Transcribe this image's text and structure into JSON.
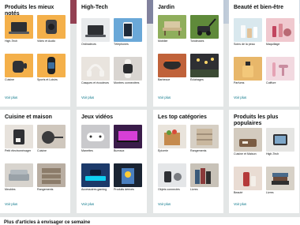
{
  "cards": [
    {
      "title": "Produits les mieux notés",
      "see_more": "Voir plus",
      "tiles": [
        {
          "caption": "High-Tech",
          "icon": "laptop-image",
          "bg": "#f4b04a"
        },
        {
          "caption": "Vidéo et Audio",
          "icon": "speaker-image",
          "bg": "#f4b04a"
        },
        {
          "caption": "Cuisine",
          "icon": "kettle-image",
          "bg": "#f4b04a"
        },
        {
          "caption": "Sports et Loisirs",
          "icon": "fitness-band-image",
          "bg": "#f4b04a"
        }
      ]
    },
    {
      "title": "High-Tech",
      "see_more": "Voir plus",
      "tiles": [
        {
          "caption": "Ordinateurs",
          "icon": "laptop-image",
          "bg": "#e8eaec"
        },
        {
          "caption": "Téléphones",
          "icon": "phone-image",
          "bg": "#6aa8d8"
        },
        {
          "caption": "Casques et écouteurs",
          "icon": "headphones-image",
          "bg": "#e9e4de"
        },
        {
          "caption": "Montres connectées",
          "icon": "smartwatch-image",
          "bg": "#d9d5d1"
        }
      ]
    },
    {
      "title": "Jardin",
      "see_more": "Voir plus",
      "tiles": [
        {
          "caption": "Mobilier",
          "icon": "garden-chair-image",
          "bg": "#8fae5c"
        },
        {
          "caption": "Tondeuses",
          "icon": "lawn-mower-image",
          "bg": "#5f8a3a"
        },
        {
          "caption": "Barbecue",
          "icon": "barbecue-image",
          "bg": "#c0623a"
        },
        {
          "caption": "Éclairages",
          "icon": "garden-light-image",
          "bg": "#2e2f33"
        }
      ]
    },
    {
      "title": "Beauté et bien-être",
      "see_more": "Voir plus",
      "tiles": [
        {
          "caption": "Soins de la peau",
          "icon": "skincare-image",
          "bg": "#d9e8ee"
        },
        {
          "caption": "Maquillage",
          "icon": "makeup-image",
          "bg": "#f0c9cf"
        },
        {
          "caption": "Parfums",
          "icon": "perfume-image",
          "bg": "#e8b76a"
        },
        {
          "caption": "Coiffure",
          "icon": "hair-tools-image",
          "bg": "#f2d9e0"
        }
      ]
    },
    {
      "title": "Cuisine et maison",
      "see_more": "Voir plus",
      "tiles": [
        {
          "caption": "Petit électroménager",
          "icon": "coffee-machine-image",
          "bg": "#e7e2dc"
        },
        {
          "caption": "Cuisine",
          "icon": "pans-image",
          "bg": "#cfc7bd"
        },
        {
          "caption": "Meubles",
          "icon": "sofa-image",
          "bg": "#d8d4ce"
        },
        {
          "caption": "Rangements",
          "icon": "storage-image",
          "bg": "#b9aea2"
        }
      ]
    },
    {
      "title": "Jeux vidéos",
      "see_more": "Voir plus",
      "tiles": [
        {
          "caption": "Manettes",
          "icon": "gamepad-image",
          "bg": "#c9c9cc"
        },
        {
          "caption": "Bureaux",
          "icon": "gaming-desk-image",
          "bg": "#3a1c4a"
        },
        {
          "caption": "Accessoires gaming",
          "icon": "gaming-accessories-image",
          "bg": "#1c3a6a"
        },
        {
          "caption": "Produits dérivés",
          "icon": "merchandise-image",
          "bg": "#1a2433"
        }
      ]
    },
    {
      "title": "Les top catégories",
      "see_more": "Voir plus",
      "tiles": [
        {
          "caption": "Épicerie",
          "icon": "grocery-image",
          "bg": "#e9e4dc"
        },
        {
          "caption": "Rangements",
          "icon": "shelves-image",
          "bg": "#d6cfc4"
        },
        {
          "caption": "Objets connectés",
          "icon": "smart-devices-image",
          "bg": "#e4e6e8"
        },
        {
          "caption": "Livres",
          "icon": "books-image",
          "bg": "#c8c2b8"
        }
      ]
    },
    {
      "title": "Produits les plus populaires",
      "see_more": "Voir plus",
      "tiles": [
        {
          "caption": "Cuisine et Maison",
          "icon": "kitchen-scale-image",
          "bg": "#d3cbbf"
        },
        {
          "caption": "High-Tech",
          "icon": "tech-gadget-image",
          "bg": "#e5e5e3"
        },
        {
          "caption": "Beauté",
          "icon": "beauty-product-image",
          "bg": "#e9dcd3"
        },
        {
          "caption": "Livres",
          "icon": "book-stack-image",
          "bg": "#d7d1c7"
        }
      ]
    }
  ],
  "bottom_section": {
    "title": "Plus d'articles à envisager ce semaine"
  }
}
